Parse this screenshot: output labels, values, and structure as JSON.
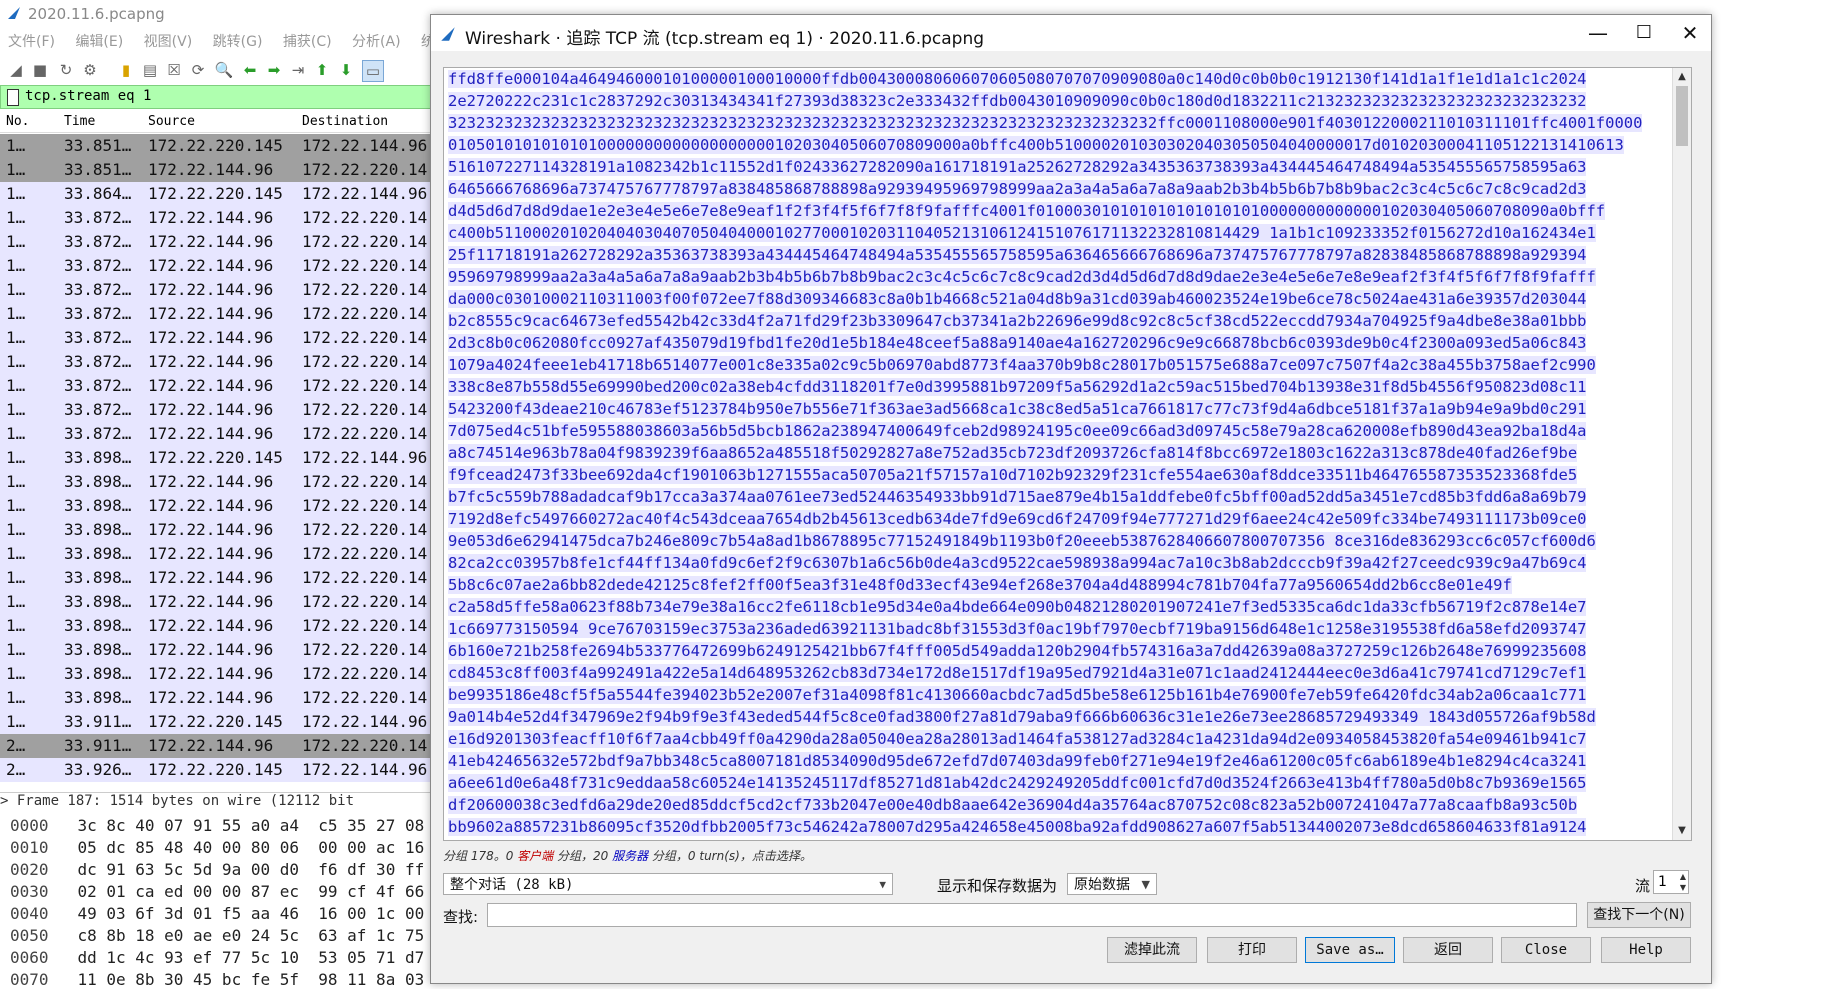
{
  "main": {
    "title": "2020.11.6.pcapng",
    "menu": [
      "文件(F)",
      "编辑(E)",
      "视图(V)",
      "跳转(G)",
      "捕获(C)",
      "分析(A)",
      "统计"
    ],
    "filter": "tcp.stream eq 1",
    "columns": {
      "no": "No.",
      "time": "Time",
      "source": "Source",
      "destination": "Destination"
    },
    "packets": [
      {
        "no": "1…",
        "time": "33.851…",
        "src": "172.22.220.145",
        "dst": "172.22.144.96",
        "sel": true
      },
      {
        "no": "1…",
        "time": "33.851…",
        "src": "172.22.144.96",
        "dst": "172.22.220.14",
        "sel": true
      },
      {
        "no": "1…",
        "time": "33.864…",
        "src": "172.22.220.145",
        "dst": "172.22.144.96"
      },
      {
        "no": "1…",
        "time": "33.872…",
        "src": "172.22.144.96",
        "dst": "172.22.220.14"
      },
      {
        "no": "1…",
        "time": "33.872…",
        "src": "172.22.144.96",
        "dst": "172.22.220.14"
      },
      {
        "no": "1…",
        "time": "33.872…",
        "src": "172.22.144.96",
        "dst": "172.22.220.14"
      },
      {
        "no": "1…",
        "time": "33.872…",
        "src": "172.22.144.96",
        "dst": "172.22.220.14"
      },
      {
        "no": "1…",
        "time": "33.872…",
        "src": "172.22.144.96",
        "dst": "172.22.220.14"
      },
      {
        "no": "1…",
        "time": "33.872…",
        "src": "172.22.144.96",
        "dst": "172.22.220.14"
      },
      {
        "no": "1…",
        "time": "33.872…",
        "src": "172.22.144.96",
        "dst": "172.22.220.14"
      },
      {
        "no": "1…",
        "time": "33.872…",
        "src": "172.22.144.96",
        "dst": "172.22.220.14"
      },
      {
        "no": "1…",
        "time": "33.872…",
        "src": "172.22.144.96",
        "dst": "172.22.220.14"
      },
      {
        "no": "1…",
        "time": "33.872…",
        "src": "172.22.144.96",
        "dst": "172.22.220.14"
      },
      {
        "no": "1…",
        "time": "33.898…",
        "src": "172.22.220.145",
        "dst": "172.22.144.96"
      },
      {
        "no": "1…",
        "time": "33.898…",
        "src": "172.22.144.96",
        "dst": "172.22.220.14"
      },
      {
        "no": "1…",
        "time": "33.898…",
        "src": "172.22.144.96",
        "dst": "172.22.220.14"
      },
      {
        "no": "1…",
        "time": "33.898…",
        "src": "172.22.144.96",
        "dst": "172.22.220.14"
      },
      {
        "no": "1…",
        "time": "33.898…",
        "src": "172.22.144.96",
        "dst": "172.22.220.14"
      },
      {
        "no": "1…",
        "time": "33.898…",
        "src": "172.22.144.96",
        "dst": "172.22.220.14"
      },
      {
        "no": "1…",
        "time": "33.898…",
        "src": "172.22.144.96",
        "dst": "172.22.220.14"
      },
      {
        "no": "1…",
        "time": "33.898…",
        "src": "172.22.144.96",
        "dst": "172.22.220.14"
      },
      {
        "no": "1…",
        "time": "33.898…",
        "src": "172.22.144.96",
        "dst": "172.22.220.14"
      },
      {
        "no": "1…",
        "time": "33.898…",
        "src": "172.22.144.96",
        "dst": "172.22.220.14"
      },
      {
        "no": "1…",
        "time": "33.898…",
        "src": "172.22.144.96",
        "dst": "172.22.220.14"
      },
      {
        "no": "1…",
        "time": "33.911…",
        "src": "172.22.220.145",
        "dst": "172.22.144.96"
      },
      {
        "no": "2…",
        "time": "33.911…",
        "src": "172.22.144.96",
        "dst": "172.22.220.14",
        "sel": true
      },
      {
        "no": "2…",
        "time": "33.926…",
        "src": "172.22.220.145",
        "dst": "172.22.144.96"
      }
    ],
    "detail": "Frame 187: 1514 bytes on wire (12112 bit",
    "hex_rows": [
      {
        "off": "0000",
        "bytes": "3c 8c 40 07 91 55 a0 a4  c5 35 27 08"
      },
      {
        "off": "0010",
        "bytes": "05 dc 85 48 40 00 80 06  00 00 ac 16"
      },
      {
        "off": "0020",
        "bytes": "dc 91 63 5c 5d 9a 00 d0  f6 df 30 ff"
      },
      {
        "off": "0030",
        "bytes": "02 01 ca ed 00 00 87 ec  99 cf 4f 66"
      },
      {
        "off": "0040",
        "bytes": "49 03 6f 3d 01 f5 aa 46  16 00 1c 00"
      },
      {
        "off": "0050",
        "bytes": "c8 8b 18 e0 ae e0 24 5c  63 af 1c 75"
      },
      {
        "off": "0060",
        "bytes": "dd 1c 4c 93 ef 77 5c 10  53 05 71 d7"
      },
      {
        "off": "0070",
        "bytes": "11 0e 8b 30 45 bc fe 5f  98 11 8a 03"
      }
    ]
  },
  "dialog": {
    "title": "Wireshark · 追踪 TCP 流 (tcp.stream eq 1) · 2020.11.6.pcapng",
    "win_buttons": {
      "min": "—",
      "max": "☐",
      "close": "✕"
    },
    "stream_lines": [
      "ffd8ffe000104a46494600010100000100010000ffdb004300080606070605080707070909080a0c140d0c0b0b0c1912130f141d1a1f1e1d1a1c1c2024",
      "2e2720222c231c1c2837292c30313434341f27393d38323c2e333432ffdb0043010909090c0b0c180d0d1832211c213232323232323232323232323232",
      "3232323232323232323232323232323232323232323232323232323232323232323232323232ffc0001108000e901f4030122000211010311101ffc4001f0000",
      "0105010101010101000000000000000000010203040506070809000a0bffc400b5100002010303020403050504040000017d01020300041105122131410613",
      "516107227114328191a1082342b1c11552d1f02433627282090a161718191a25262728292a3435363738393a434445464748494a535455565758595a63",
      "6465666768696a737475767778797a838485868788898a92939495969798999aa2a3a4a5a6a7a8a9aab2b3b4b5b6b7b8b9bac2c3c4c5c6c7c8c9cad2d3",
      "d4d5d6d7d8d9dae1e2e3e4e5e6e7e8e9eaf1f2f3f4f5f6f7f8f9fafffc4001f0100030101010101010101010000000000000102030405060708090a0bfff",
      "c400b5110002010204040304070504040001027700010203110405213106124151076171132232810814429 1a1b1c109233352f0156272d10a162434e1",
      "25f11718191a262728292a35363738393a434445464748494a535455565758595a636465666768696a737475767778797a82838485868788898a929394",
      "95969798999aa2a3a4a5a6a7a8a9aab2b3b4b5b6b7b8b9bac2c3c4c5c6c7c8c9cad2d3d4d5d6d7d8d9dae2e3e4e5e6e7e8e9eaf2f3f4f5f6f7f8f9fafff",
      "da000c03010002110311003f00f072ee7f88d309346683c8a0b1b4668c521a04d8b9a31cd039ab460023524e19be6ce78c5024ae431a6e39357d203044",
      "b2c8555c9cac64673efed5542b42c33d4f2a71fd29f23b3309647cb37341a2b22696e99d8c92c8c5cf38cd522eccdd7934a704925f9a4dbe8e38a01bbb",
      "2d3c8b0c062080fcc0927af435079d19fbd1fe20d1e5b184e48ceef5a88a9140ae4a162720296c9e9c66878bcb6c0393de9b0c4f2300a093ed5a06c843",
      "1079a4024feee1eb41718b6514077e001c8e335a02c9c5b06970abd8773f4aa370b9b8c28017b051575e688a7ce097c7507f4a2c38a455b3758aef2c990",
      "338c8e87b558d55e69990bed200c02a38eb4cfdd3118201f7e0d3995881b97209f5a56292d1a2c59ac515bed704b13938e31f8d5b4556f950823d08c11",
      "5423200f43deae210c46783ef5123784b950e7b556e71f363ae3ad5668ca1c38c8ed5a51ca7661817c77c73f9d4a6dbce5181f37a1a9b94e9a9bd0c291",
      "7d075ed4c51bfe595588038603a56b5d5bcb1862a238947400649fceb2d98924195c0ee09c66ad3d09745c58e79a28ca620008efb890d43ea92ba18d4a",
      "a8c74514e963b78a04f9839239f6aa8652a485518f50292827a8e752ad35cb723df2093726cfa814f8bcc6972e1803c1622a313c878de40fad26ef9be",
      "f9fcead2473f33bee692da4cf1901063b1271555aca50705a21f57157a10d7102b92329f231cfe554ae630af8ddce33511b464765587353523368fde5",
      "b7fc5c559b788adadcaf9b17cca3a374aa0761ee73ed52446354933bb91d715ae879e4b15a1ddfebe0fc5bff00ad52dd5a3451e7cd85b3fdd6a8a69b79",
      "7192d8efc5497660272ac40f4c543dceaa7654db2b45613cedb634de7fd9e69cd6f24709f94e777271d29f6aee24c42e509fc334be7493111173b09ce0",
      "9e053d6e62941475dca7b246e809c7b54a8ad1b8678895c77152491849b1193b0f20eeeb5387628406607800707356 8ce316de836293cc6c057cf600d6",
      "82ca2cc03957b8fe1cf44ff134a0fd9c6ef2f9c6307b1a6c56b0de4a3cd9522cae598938a994ac7a10c3b8ab2dcccb9f39a42f27ceedc939c9a47b69c4",
      "5b8c6c07ae2a6bb82dede42125c8fef2ff00f5ea3f31e48f0d33ecf43e94ef268e3704a4d488994c781b704fa77a9560654dd2b6cc8e01e49f",
      "c2a58d5ffe58a0623f88b734e79e38a16cc2fe6118cb1e95d34e0a4bde664e090b04821280201907241e7f3ed5335ca6dc1da33cfb56719f2c878e14e7",
      "1c669773150594 9ce76703159ec3753a236aded63921131badc8bf31553d3f0ac19bf7970ecbf719ba9156d648e1c1258e3195538fd6a58efd2093747",
      "6b160e721b258fe2694b533776472699b6249125421bb67f4fff005d549adda120b2904fb574316a3a7dd42639a08a3727259c126b2648e76999235608",
      "cd8453c8ff003f4a992491a422e5a14d648953262cb83d734e172d8e1517df19a95ed7921d4a31e071c1aad2412444eec0e3d6a41c79741cd7129c7ef1",
      "be9935186e48cf5f5a5544fe394023b52e2007ef31a4098f81c4130660acbdc7ad5d5be58e6125b161b4e76900fe7eb59fe6420fdc34ab2a06caa1c771",
      "9a014b4e52d4f347969e2f94b9f9e3f43eded544f5c8ce0fad3800f27a81d79aba9f666b60636c31e1e26e73ee28685729493349 1843d055726af9b58d",
      "e16d9201303feacff10f6f7aa4cbb49ff0a4290da28a05040ea28a28013ad1464fa538127ad3284c1a4231da94d2e0934058453820fa54e09461b941c7",
      "41eb42465632e572bdf9a7bb348c5ca8007181d8534090d95de672efd7d07403da99feb0f271e94e19f2e46a61200c05fc6ab6189e4b1e8294c4ca3241",
      "a6ee61d0e6a48f731c9eddaa58c60524e14135245117df85271d81ab42dc2429249205ddfc001cfd7d0d3524f2663e413b4ff780a5d0b8c7b9369e1565",
      "df20600038c3edfd6a29de20ed85ddcf5cd2cf733b2047e00e40db8aae642e36904d4a35764ac870752c08c823a52b007241047a77a8caafb8a93c50b",
      "bb9602a8857231b86095cf3520dfbb2005f73c546242a78007d295a424658e45008ba92afdd908627a607f5ab51344002073e8dcd658604633f81a9124"
    ],
    "highlight_from": 24,
    "summary": {
      "prefix": "分组 178。0 ",
      "client": "客户端",
      "mid": " 分组，20 ",
      "server": "服务器",
      "suffix": " 分组，0 turn(s)，点击选择。"
    },
    "conversation": "整个对话 (28 kB)",
    "show_as_label": "显示和保存数据为",
    "show_as_value": "原始数据",
    "stream_label": "流",
    "stream_value": "1",
    "find_label": "查找:",
    "find_value": "",
    "find_next": "查找下一个(N)",
    "buttons": {
      "filter_out": "滤掉此流",
      "print": "打印",
      "save_as": "Save as…",
      "back": "返回",
      "close": "Close",
      "help": "Help"
    }
  }
}
